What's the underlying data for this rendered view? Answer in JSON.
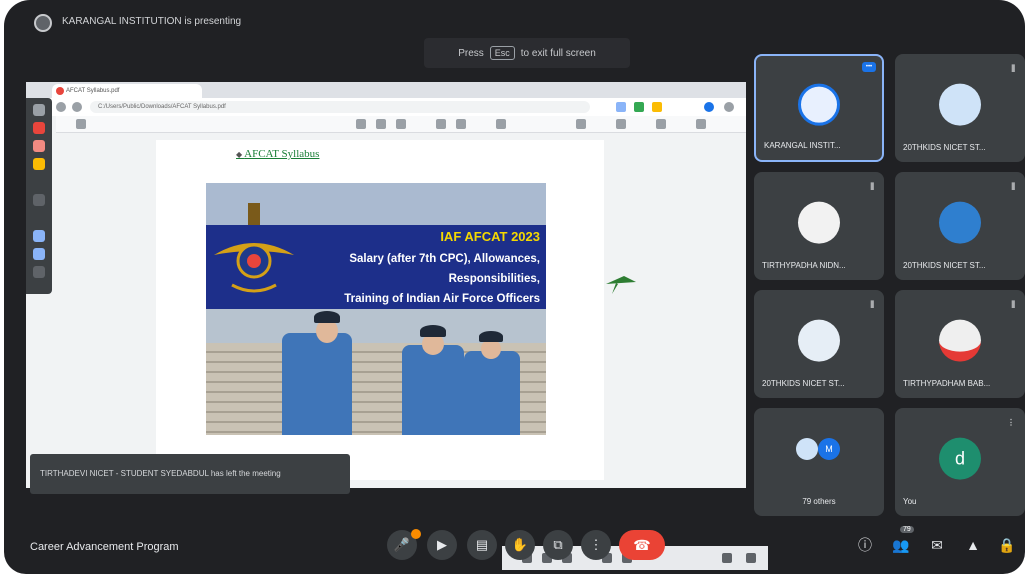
{
  "presenting_banner": "KARANGAL INSTITUTION is presenting",
  "esc_hint": {
    "prefix": "Press",
    "key": "Esc",
    "suffix": "to exit full screen"
  },
  "browser": {
    "tab_title": "AFCAT Syllabus.pdf",
    "address": "C:/Users/Public/Downloads/AFCAT Syllabus.pdf"
  },
  "document": {
    "bullet_link": "AFCAT Syllabus",
    "banner_title": "IAF AFCAT 2023",
    "banner_lines": [
      "Salary (after 7th CPC), Allowances,",
      "Responsibilities,",
      "Training of Indian Air Force Officers"
    ]
  },
  "toast": "TIRTHADEVI NICET - STUDENT SYEDABDUL has left the meeting",
  "participants": [
    {
      "name": "KARANGAL INSTIT...",
      "avatar_color": "#e8f0fe",
      "active": true
    },
    {
      "name": "20THKIDS NICET ST...",
      "avatar_color": "#cfe3f8",
      "active": false
    },
    {
      "name": "TIRTHYPADHA NIDN...",
      "avatar_color": "#f2f2f2",
      "active": false
    },
    {
      "name": "20THKIDS NICET ST...",
      "avatar_color": "#2f7fcf",
      "active": false
    },
    {
      "name": "20THKIDS NICET ST...",
      "avatar_color": "#e6eef6",
      "active": false
    },
    {
      "name": "TIRTHYPADHAM BAB...",
      "avatar_color": "#efefef",
      "active": false
    },
    {
      "name": "79 others",
      "avatar_color": "#1a73e8",
      "active": false
    },
    {
      "name": "You",
      "avatar_color": "#1e8e6e",
      "initial": "d",
      "active": false
    }
  ],
  "meeting_title": "Career Advancement Program",
  "controls": {
    "mic": "🎤",
    "camera": "▶",
    "captions": "▤",
    "raise_hand": "✋",
    "present": "⧉",
    "more": "⋮",
    "end_call": "☎"
  },
  "right_controls": {
    "info": "ⓘ",
    "people": "👥",
    "chat": "✉",
    "activities": "▲",
    "lock": "🔒"
  },
  "people_badge": "79",
  "colors": {
    "background": "#202124",
    "tile": "#3c4043",
    "end_call": "#ea4335",
    "active_border": "#8ab4f8",
    "banner_blue": "#1d2f8a",
    "banner_yellow": "#f5d800"
  }
}
